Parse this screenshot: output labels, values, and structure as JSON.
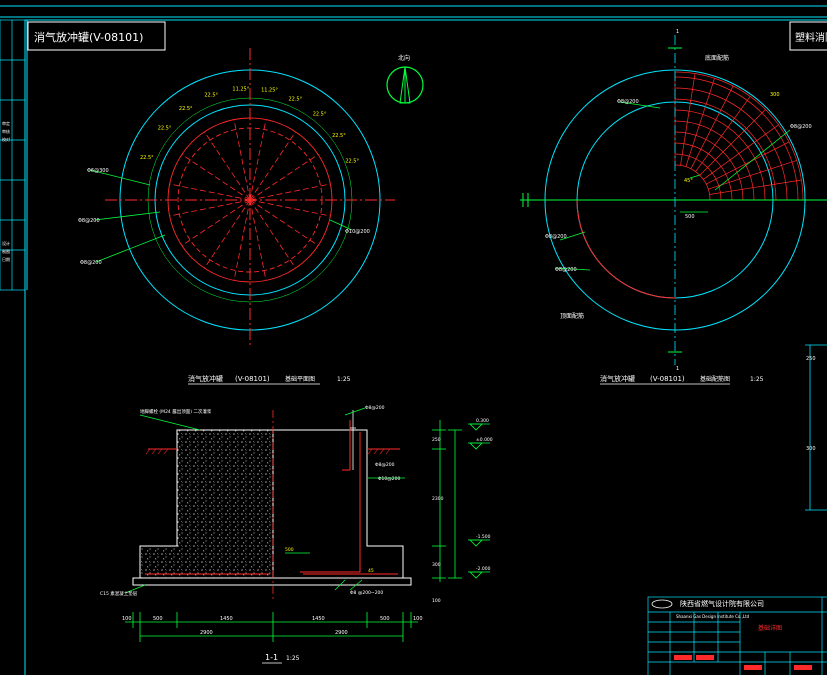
{
  "drawing": {
    "title_box_left": "消气放冲罐(V-08101)",
    "title_box_right": "塑料消防给",
    "north_label": "北向",
    "plan_view": {
      "caption_name": "消气放冲罐",
      "caption_tag": "(V-08101)",
      "caption_view": "基础平面图",
      "caption_scale": "1:25",
      "angle_labels": [
        "11.25°",
        "11.25°",
        "22.5°",
        "22.5°",
        "22.5°",
        "22.5°",
        "22.5°",
        "22.5°",
        "22.5°",
        "22.5°"
      ],
      "callouts": [
        "Φ6@300",
        "Φ8@200",
        "Φ8@200",
        "Φ8@200",
        "Φ10@200"
      ]
    },
    "rebar_view": {
      "caption_name": "消气放冲罐",
      "caption_tag": "(V-08101)",
      "caption_view": "基础配筋图",
      "caption_scale": "1:25",
      "top_label": "底面配筋",
      "bottom_label": "顶面配筋",
      "dim_300": "300",
      "dim_500": "500",
      "dim_45": "45°",
      "callouts": [
        "Φ8@200",
        "Φ8@200",
        "Φ8@200",
        "Φ8@200",
        "Φ8@200"
      ]
    },
    "section": {
      "caption": "1-1",
      "caption_scale": "1:25",
      "top_note": "地脚螺栓 (M24 露出顶面) 二次灌浆",
      "dims_bottom_row1": [
        "500",
        "1450",
        "1450",
        "500"
      ],
      "dims_bottom_row2": [
        "2900",
        "2900"
      ],
      "dims_outer": [
        "100",
        "100"
      ],
      "label_500": "500",
      "label_45": "45",
      "right_dims": [
        "250",
        "2300",
        "300",
        "100"
      ],
      "levels": [
        "0.300",
        "±0.000",
        "-1.500",
        "-2.000"
      ],
      "rebar_notes": [
        "Φ8@200",
        "Φ8@200",
        "Φ10@200",
        "Φ8 @200~200"
      ],
      "pad_note": "C15 素混凝土垫层"
    },
    "title_block": {
      "company_cn": "陕西省燃气设计院有限公司",
      "company_en": "Shaanxi Gas Design Institute Co.,Ltd",
      "drawing_name": "基础详图"
    },
    "left_strip": [
      "审定",
      "审核",
      "校对",
      "设计",
      "制图",
      "日期"
    ],
    "colors": {
      "frame": "#00e5ff",
      "concrete": "#ffffff",
      "rebar": "#ff2a2a",
      "dims": "#00ff3c",
      "text": "#ffffff",
      "accent": "#ffff00"
    }
  }
}
